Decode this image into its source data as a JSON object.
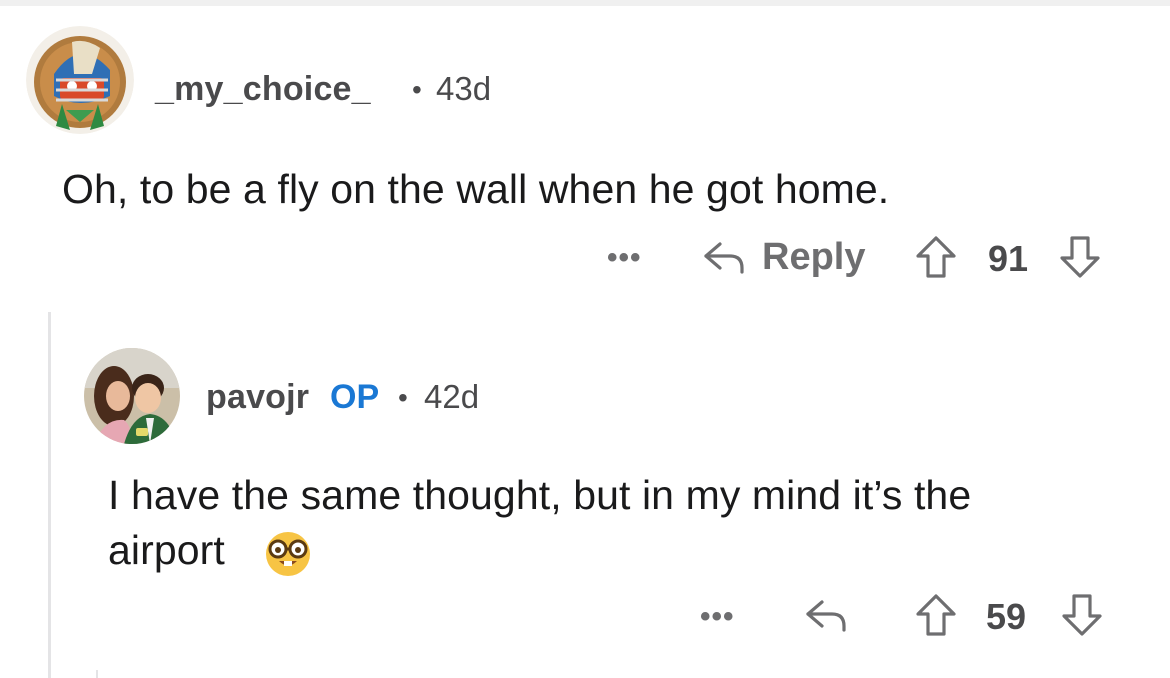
{
  "comments": [
    {
      "username": "_my_choice_",
      "separator": "•",
      "age": "43d",
      "text": "Oh, to be a fly on the wall when he got home.",
      "more": "•••",
      "reply_label": "Reply",
      "votes": "91",
      "icons": {
        "avatar": "football-helmet-avatar",
        "reply": "reply-arrow-icon",
        "upvote": "upvote-arrow-icon",
        "downvote": "downvote-arrow-icon"
      }
    },
    {
      "username": "pavojr",
      "badge": "OP",
      "separator": "•",
      "age": "42d",
      "text_line1": "I have the same thought, but in my mind it’s the",
      "text_line2": "airport",
      "emoji": "🤓",
      "more": "•••",
      "votes": "59",
      "icons": {
        "avatar": "photo-avatar",
        "reply": "reply-arrow-icon",
        "upvote": "upvote-arrow-icon",
        "downvote": "downvote-arrow-icon"
      }
    }
  ],
  "colors": {
    "op_badge": "#1a78d4",
    "meta_text": "#4a4a4c",
    "action_text": "#6e6e70",
    "body_text": "#1a1a1b"
  }
}
